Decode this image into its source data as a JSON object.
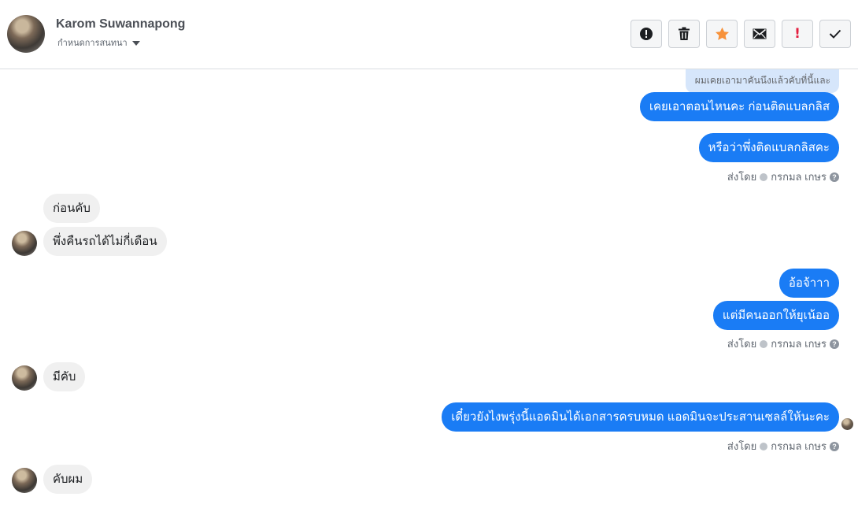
{
  "header": {
    "contact_name": "Karom Suwannapong",
    "subtitle": "กำหนดการสนทนา"
  },
  "toolbar": {
    "buttons": [
      {
        "icon": "alert-circle-icon"
      },
      {
        "icon": "trash-icon"
      },
      {
        "icon": "star-icon",
        "color": "#f7923b"
      },
      {
        "icon": "envelope-icon"
      },
      {
        "icon": "exclamation-icon",
        "text": "!",
        "color": "#e41e3f"
      },
      {
        "icon": "checkmark-icon"
      }
    ]
  },
  "colors": {
    "outgoing_bubble": "#1a7cf5",
    "incoming_bubble": "#f0f0f0",
    "reply_hint": "#d6e6fb"
  },
  "conversation": {
    "reply_hint": "ผมเคยเอามาคันนึงแล้วคับที่นี้และ",
    "messages": [
      {
        "direction": "out",
        "text": "เคยเอาตอนไหนคะ ก่อนติดแบลกลิส"
      },
      {
        "direction": "out",
        "text": "หรือว่าพึ่งติดแบลกลิสคะ"
      },
      {
        "direction": "in",
        "text": "ก่อนคับ"
      },
      {
        "direction": "in",
        "text": "พึ่งคืนรถได้ไม่กี่เดือน"
      },
      {
        "direction": "out",
        "text": "อ้อจ้าาา"
      },
      {
        "direction": "out",
        "text": "แต่มีคนออกให้ยุเน้ออ"
      },
      {
        "direction": "in",
        "text": "มีคับ"
      },
      {
        "direction": "out",
        "text": "เดี๋ยวยังไงพรุ่งนี้แอดมินได้เอกสารครบหมด แอดมินจะประสานเซลล์ให้นะคะ"
      },
      {
        "direction": "in",
        "text": "คับผม"
      }
    ],
    "sent_by": {
      "prefix": "ส่งโดย",
      "agent": "กรกมล เกษร",
      "help": "?"
    }
  }
}
